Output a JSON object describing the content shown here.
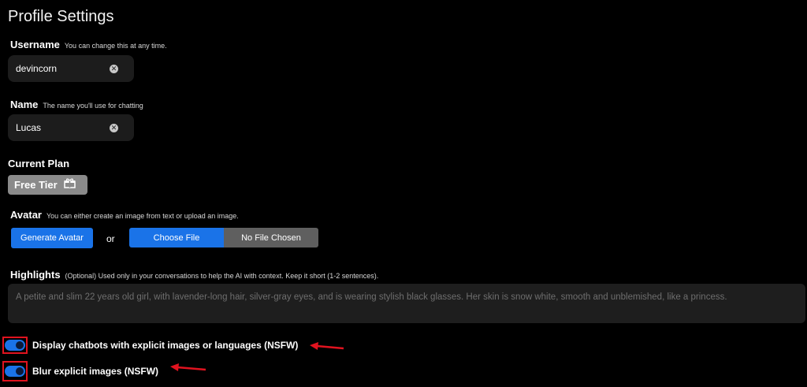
{
  "page": {
    "title": "Profile Settings"
  },
  "username": {
    "label": "Username",
    "hint": "You can change this at any time.",
    "value": "devincorn",
    "clear_icon": "clear-circle-icon"
  },
  "name": {
    "label": "Name",
    "hint": "The name you'll use for chatting",
    "value": "Lucas",
    "clear_icon": "clear-circle-icon"
  },
  "plan": {
    "label": "Current Plan",
    "badge": "Free Tier",
    "badge_icon": "gift-icon"
  },
  "avatar": {
    "label": "Avatar",
    "hint": "You can either create an image from text or upload an image.",
    "generate_button": "Generate Avatar",
    "or_text": "or",
    "choose_file": "Choose File",
    "no_file": "No File Chosen"
  },
  "highlights": {
    "label": "Highlights",
    "hint": "(Optional) Used only in your conversations to help the AI with context. Keep it short (1-2 sentences).",
    "placeholder": "A petite and slim 22 years old girl, with lavender-long hair, silver-gray eyes, and is wearing stylish black glasses. Her skin is snow white, smooth and unblemished, like a princess."
  },
  "toggles": [
    {
      "label": "Display chatbots with explicit images or languages (NSFW)",
      "on": true
    },
    {
      "label": "Blur explicit images (NSFW)",
      "on": true
    }
  ],
  "colors": {
    "accent": "#1a73e8",
    "highlight_frame": "#e0131f",
    "annotation_arrow": "#e0131f"
  }
}
